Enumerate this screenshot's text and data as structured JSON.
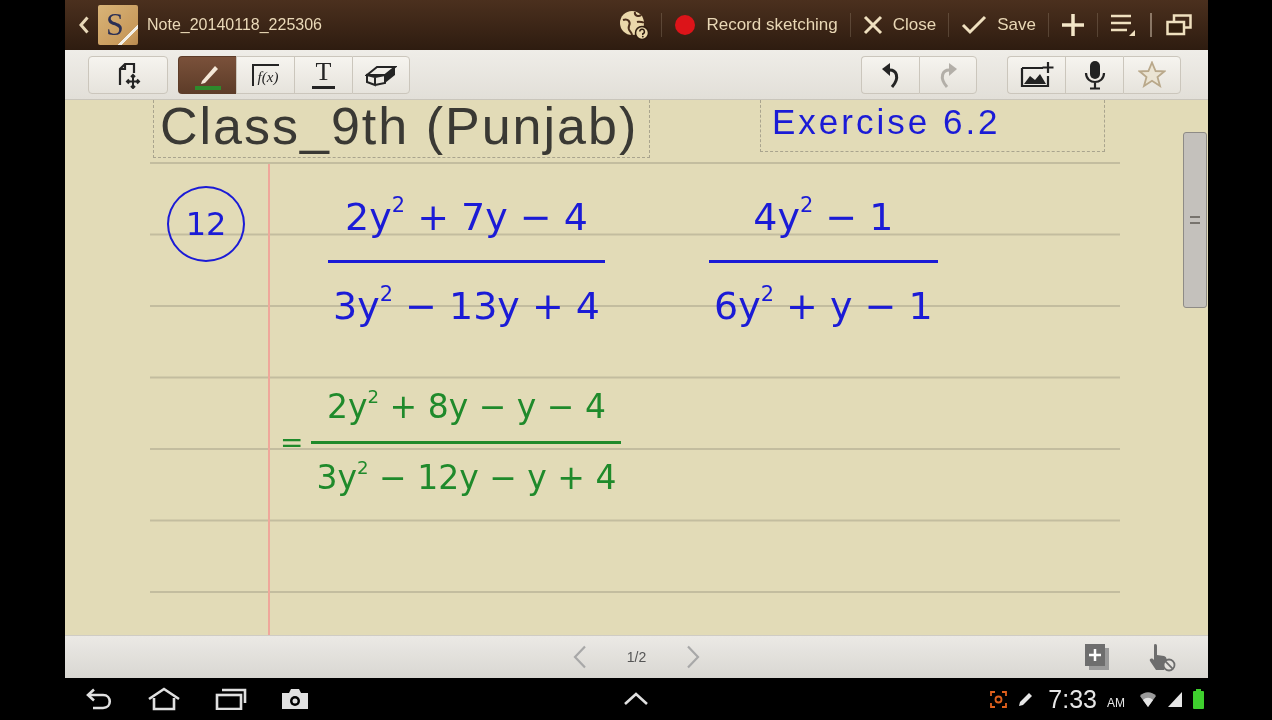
{
  "title_bar": {
    "logo_letter": "S",
    "title": "Note_20140118_225306",
    "actions": [
      {
        "kind": "record",
        "label": "Record sketching"
      },
      {
        "kind": "close",
        "label": "Close"
      },
      {
        "kind": "save",
        "label": "Save"
      }
    ]
  },
  "toolbar": {
    "tools": [
      {
        "kind": "select",
        "selected": false
      },
      {
        "kind": "pen",
        "selected": true
      },
      {
        "kind": "formula",
        "glyph": "f(x)",
        "selected": false
      },
      {
        "kind": "text",
        "glyph": "T",
        "selected": false
      },
      {
        "kind": "eraser",
        "selected": false
      }
    ],
    "history": [
      {
        "kind": "undo",
        "disabled": false
      },
      {
        "kind": "redo",
        "disabled": true
      }
    ]
  },
  "note": {
    "text_boxes": [
      {
        "kind": "typed",
        "text": "Class_9th (Punjab)"
      },
      {
        "kind": "handwritten",
        "text": "Exercise 6.2"
      }
    ],
    "problem": {
      "number": "12",
      "fractions": [
        {
          "numerator": "2y$^{2}$ + 7y − 4",
          "denominator": "3y$^{2}$ − 13y + 4",
          "color": "#1b1bd6"
        },
        {
          "numerator": "4y$^{2}$ − 1",
          "denominator": "6y$^{2}$ + y − 1",
          "color": "#1b1bd6"
        }
      ]
    },
    "steps": [
      {
        "prefix": "=",
        "numerator": "2y$^{2}$ + 8y − y − 4",
        "denominator": "3y$^{2}$ − 12y − y + 4",
        "color": "#1f8a2b"
      }
    ]
  },
  "pager": {
    "label": "1/2"
  },
  "status_bar": {
    "time": "7:33",
    "meridiem": "AM"
  }
}
